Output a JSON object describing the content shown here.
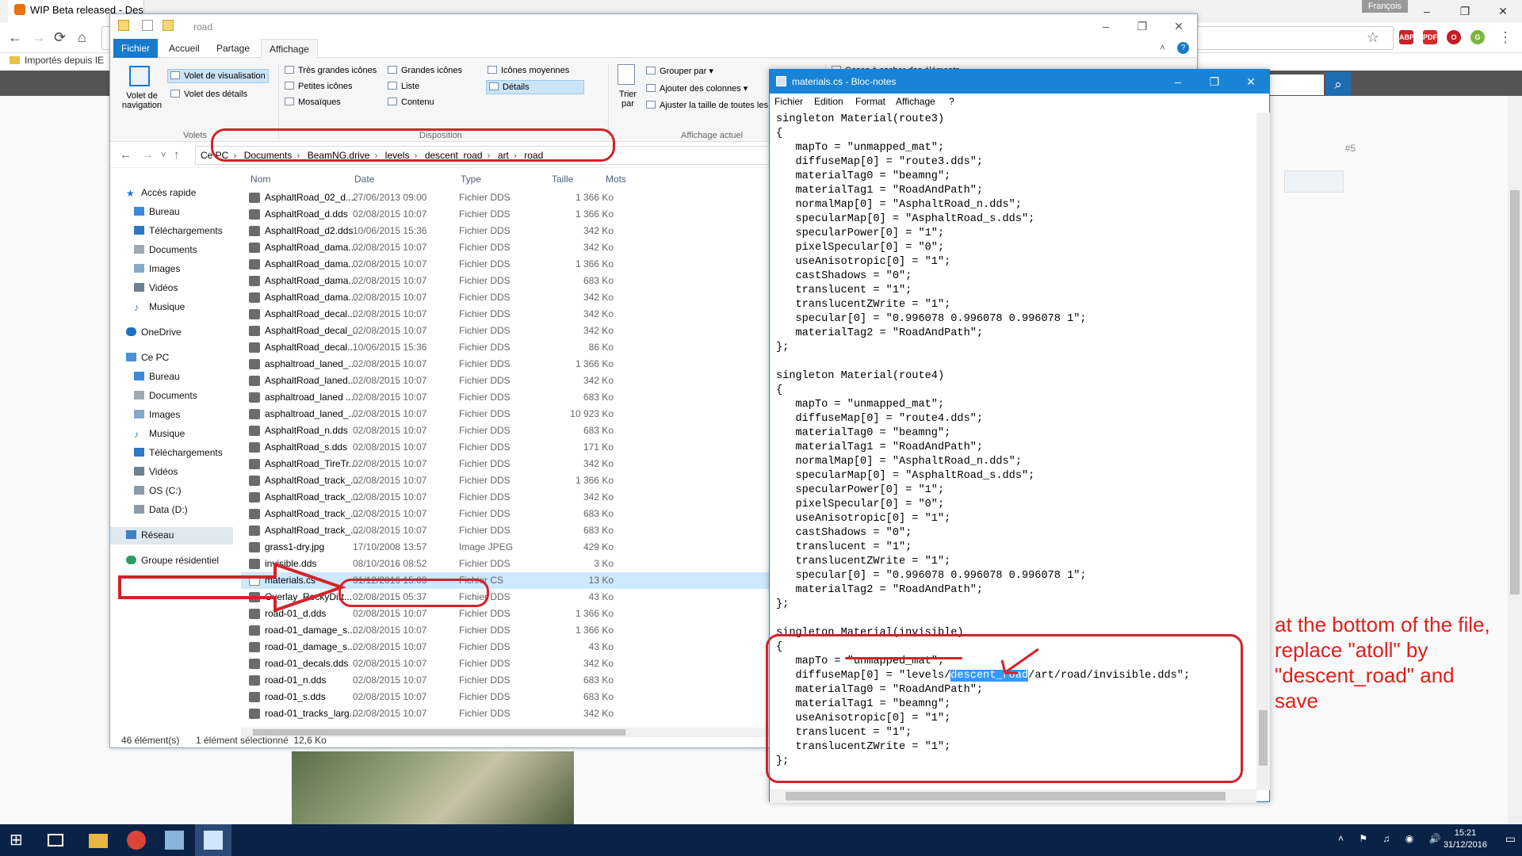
{
  "browser": {
    "tab_title": "WIP Beta released - Des",
    "user_name": "François",
    "bookmark": "Importés depuis IE",
    "win_minimize": "–",
    "win_maximize": "❐",
    "win_close": "✕",
    "extensions": [
      "ABP",
      "PDF",
      "O",
      "G"
    ]
  },
  "forum": {
    "post_number": "#5"
  },
  "explorer": {
    "title": "road",
    "ribbon_tabs": [
      "Fichier",
      "Accueil",
      "Partage",
      "Affichage"
    ],
    "ribbon": {
      "volet_navigation": "Volet de navigation",
      "volet_visualisation": "Volet de visualisation",
      "volet_details": "Volet des détails",
      "group_volets": "Volets",
      "tres_grandes": "Très grandes icônes",
      "grandes": "Grandes icônes",
      "moyennes": "Icônes moyennes",
      "petites": "Petites icônes",
      "liste": "Liste",
      "details": "Détails",
      "mosaiques": "Mosaïques",
      "contenu": "Contenu",
      "group_disposition": "Disposition",
      "trier_par": "Trier par",
      "grouper_par": "Grouper par",
      "ajouter_colonnes": "Ajouter des colonnes",
      "ajuster_taille": "Ajuster la taille de toutes les",
      "group_affichage": "Affichage actuel",
      "cases_cocher": "Cases à cocher des éléments"
    },
    "breadcrumb": [
      "Ce PC",
      "Documents",
      "BeamNG.drive",
      "levels",
      "descent_road",
      "art",
      "road"
    ],
    "nav": {
      "acces_rapide": "Accès rapide",
      "quick": [
        "Bureau",
        "Téléchargements",
        "Documents",
        "Images",
        "Vidéos",
        "Musique"
      ],
      "onedrive": "OneDrive",
      "ce_pc": "Ce PC",
      "pc": [
        "Bureau",
        "Documents",
        "Images",
        "Musique",
        "Téléchargements",
        "Vidéos",
        "OS (C:)",
        "Data (D:)"
      ],
      "reseau": "Réseau",
      "groupe": "Groupe résidentiel"
    },
    "columns": [
      "Nom",
      "Date",
      "Type",
      "Taille",
      "Mots"
    ],
    "files": [
      [
        "AsphaltRoad_02_d....",
        "27/06/2013 09:00",
        "Fichier DDS",
        "1 366 Ko"
      ],
      [
        "AsphaltRoad_d.dds",
        "02/08/2015 10:07",
        "Fichier DDS",
        "1 366 Ko"
      ],
      [
        "AsphaltRoad_d2.dds",
        "10/06/2015 15:36",
        "Fichier DDS",
        "342 Ko"
      ],
      [
        "AsphaltRoad_dama...",
        "02/08/2015 10:07",
        "Fichier DDS",
        "342 Ko"
      ],
      [
        "AsphaltRoad_dama...",
        "02/08/2015 10:07",
        "Fichier DDS",
        "1 366 Ko"
      ],
      [
        "AsphaltRoad_dama...",
        "02/08/2015 10:07",
        "Fichier DDS",
        "683 Ko"
      ],
      [
        "AsphaltRoad_dama...",
        "02/08/2015 10:07",
        "Fichier DDS",
        "342 Ko"
      ],
      [
        "AsphaltRoad_decal...",
        "02/08/2015 10:07",
        "Fichier DDS",
        "342 Ko"
      ],
      [
        "AsphaltRoad_decal_...",
        "02/08/2015 10:07",
        "Fichier DDS",
        "342 Ko"
      ],
      [
        "AsphaltRoad_decal...",
        "10/06/2015 15:36",
        "Fichier DDS",
        "86 Ko"
      ],
      [
        "asphaltroad_laned_...",
        "02/08/2015 10:07",
        "Fichier DDS",
        "1 366 Ko"
      ],
      [
        "AsphaltRoad_laned...",
        "02/08/2015 10:07",
        "Fichier DDS",
        "342 Ko"
      ],
      [
        "asphaltroad_laned ...",
        "02/08/2015 10:07",
        "Fichier DDS",
        "683 Ko"
      ],
      [
        "asphaltroad_laned_...",
        "02/08/2015 10:07",
        "Fichier DDS",
        "10 923 Ko"
      ],
      [
        "AsphaltRoad_n.dds",
        "02/08/2015 10:07",
        "Fichier DDS",
        "683 Ko"
      ],
      [
        "AsphaltRoad_s.dds",
        "02/08/2015 10:07",
        "Fichier DDS",
        "171 Ko"
      ],
      [
        "AsphaltRoad_TireTr...",
        "02/08/2015 10:07",
        "Fichier DDS",
        "342 Ko"
      ],
      [
        "AsphaltRoad_track_...",
        "02/08/2015 10:07",
        "Fichier DDS",
        "1 366 Ko"
      ],
      [
        "AsphaltRoad_track_...",
        "02/08/2015 10:07",
        "Fichier DDS",
        "342 Ko"
      ],
      [
        "AsphaltRoad_track_...",
        "02/08/2015 10:07",
        "Fichier DDS",
        "683 Ko"
      ],
      [
        "AsphaltRoad_track_...",
        "02/08/2015 10:07",
        "Fichier DDS",
        "683 Ko"
      ],
      [
        "grass1-dry.jpg",
        "17/10/2008 13:57",
        "Image JPEG",
        "429 Ko"
      ],
      [
        "invisible.dds",
        "08/10/2016 08:52",
        "Fichier DDS",
        "3 Ko"
      ],
      [
        "materials.cs",
        "31/12/2016 15:03",
        "Fichier CS",
        "13 Ko"
      ],
      [
        "Overlay_RockyDirt...",
        "02/08/2015 05:37",
        "Fichier DDS",
        "43 Ko"
      ],
      [
        "road-01_d.dds",
        "02/08/2015 10:07",
        "Fichier DDS",
        "1 366 Ko"
      ],
      [
        "road-01_damage_s...",
        "02/08/2015 10:07",
        "Fichier DDS",
        "1 366 Ko"
      ],
      [
        "road-01_damage_s...",
        "02/08/2015 10:07",
        "Fichier DDS",
        "43 Ko"
      ],
      [
        "road-01_decals.dds",
        "02/08/2015 10:07",
        "Fichier DDS",
        "342 Ko"
      ],
      [
        "road-01_n.dds",
        "02/08/2015 10:07",
        "Fichier DDS",
        "683 Ko"
      ],
      [
        "road-01_s.dds",
        "02/08/2015 10:07",
        "Fichier DDS",
        "683 Ko"
      ],
      [
        "road-01_tracks_larg...",
        "02/08/2015 10:07",
        "Fichier DDS",
        "342 Ko"
      ]
    ],
    "status_count": "46 élément(s)",
    "status_selected": "1 élément sélectionné  12,6 Ko"
  },
  "notepad": {
    "title": "materials.cs - Bloc-notes",
    "menu": [
      "Fichier",
      "Edition",
      "Format",
      "Affichage",
      "?"
    ],
    "text_before": "singleton Material(route3)\n{\n   mapTo = \"unmapped_mat\";\n   diffuseMap[0] = \"route3.dds\";\n   materialTag0 = \"beamng\";\n   materialTag1 = \"RoadAndPath\";\n   normalMap[0] = \"AsphaltRoad_n.dds\";\n   specularMap[0] = \"AsphaltRoad_s.dds\";\n   specularPower[0] = \"1\";\n   pixelSpecular[0] = \"0\";\n   useAnisotropic[0] = \"1\";\n   castShadows = \"0\";\n   translucent = \"1\";\n   translucentZWrite = \"1\";\n   specular[0] = \"0.996078 0.996078 0.996078 1\";\n   materialTag2 = \"RoadAndPath\";\n};\n\nsingleton Material(route4)\n{\n   mapTo = \"unmapped_mat\";\n   diffuseMap[0] = \"route4.dds\";\n   materialTag0 = \"beamng\";\n   materialTag1 = \"RoadAndPath\";\n   normalMap[0] = \"AsphaltRoad_n.dds\";\n   specularMap[0] = \"AsphaltRoad_s.dds\";\n   specularPower[0] = \"1\";\n   pixelSpecular[0] = \"0\";\n   useAnisotropic[0] = \"1\";\n   castShadows = \"0\";\n   translucent = \"1\";\n   translucentZWrite = \"1\";\n   specular[0] = \"0.996078 0.996078 0.996078 1\";\n   materialTag2 = \"RoadAndPath\";\n};\n\nsingleton Material(invisible)\n{\n   mapTo = \"unmapped_mat\";\n   diffuseMap[0] = \"levels/",
    "text_selected": "descent_road",
    "text_after": "/art/road/invisible.dds\";\n   materialTag0 = \"RoadAndPath\";\n   materialTag1 = \"beamng\";\n   useAnisotropic[0] = \"1\";\n   translucent = \"1\";\n   translucentZWrite = \"1\";\n};"
  },
  "annotation": "at the bottom of the file, replace \"atoll\" by \"descent_road\" and save",
  "taskbar": {
    "time": "15:21",
    "date": "31/12/2016"
  },
  "colors": {
    "accent": "#1979ca",
    "annotation_red": "#e0201b",
    "taskbar": "#0b2247"
  }
}
